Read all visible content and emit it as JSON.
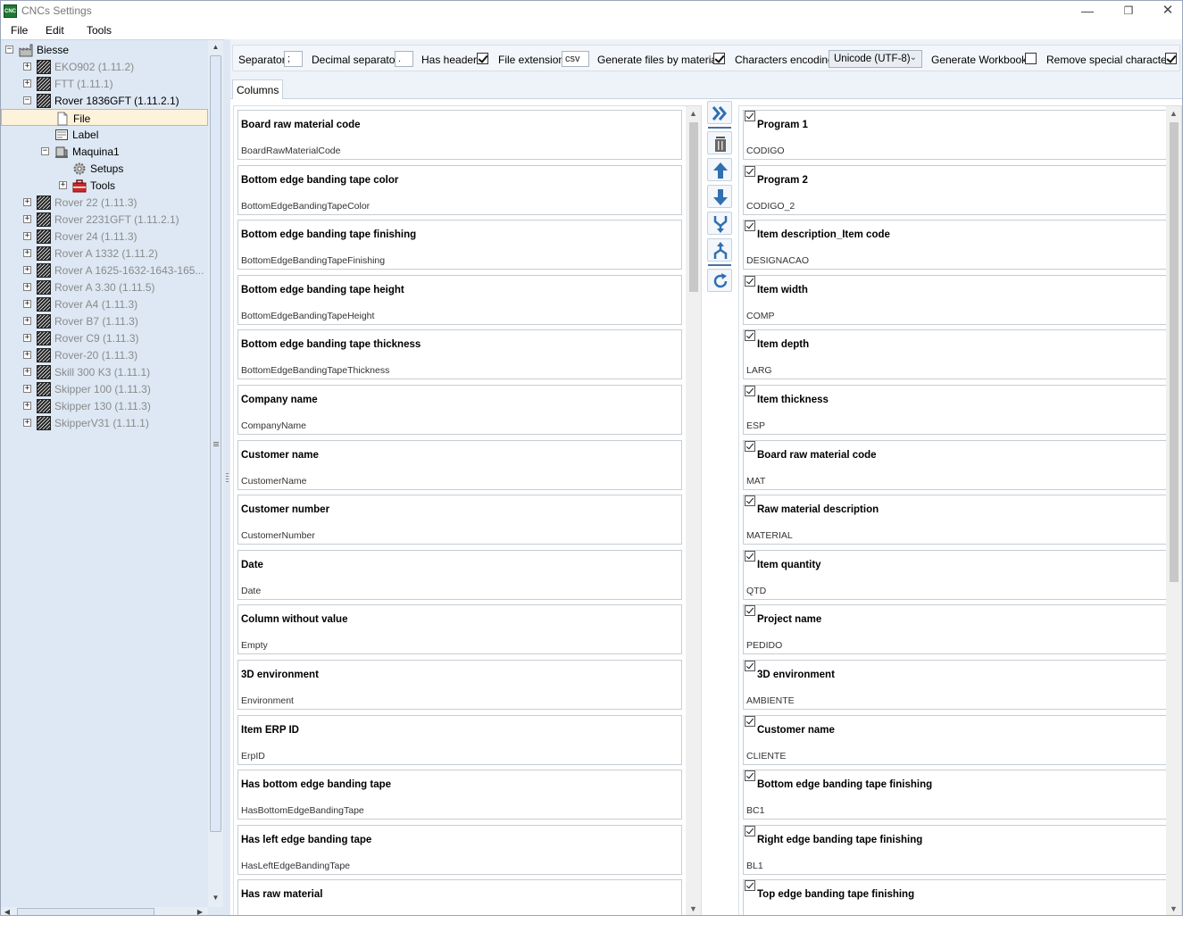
{
  "window": {
    "title": "CNCs Settings",
    "app_icon_text": "CNC",
    "min_glyph": "—",
    "max_glyph": "❐",
    "close_glyph": "✕"
  },
  "menu": [
    "File",
    "Edit",
    "Tools"
  ],
  "tree": {
    "root": "Biesse",
    "items": [
      {
        "label": "EKO902 (1.11.2)",
        "muted": true
      },
      {
        "label": "FTT (1.11.1)",
        "muted": true
      },
      {
        "label": "Rover 1836GFT (1.11.2.1)",
        "muted": false
      },
      {
        "label": "File",
        "muted": false
      },
      {
        "label": "Label",
        "muted": false
      },
      {
        "label": "Maquina1",
        "muted": false
      },
      {
        "label": "Setups",
        "muted": false
      },
      {
        "label": "Tools",
        "muted": false
      },
      {
        "label": "Rover 22 (1.11.3)",
        "muted": true
      },
      {
        "label": "Rover 2231GFT (1.11.2.1)",
        "muted": true
      },
      {
        "label": "Rover 24 (1.11.3)",
        "muted": true
      },
      {
        "label": "Rover A 1332 (1.11.2)",
        "muted": true
      },
      {
        "label": "Rover A 1625-1632-1643-165...",
        "muted": true
      },
      {
        "label": "Rover A 3.30 (1.11.5)",
        "muted": true
      },
      {
        "label": "Rover A4 (1.11.3)",
        "muted": true
      },
      {
        "label": "Rover B7 (1.11.3)",
        "muted": true
      },
      {
        "label": "Rover C9 (1.11.3)",
        "muted": true
      },
      {
        "label": "Rover-20 (1.11.3)",
        "muted": true
      },
      {
        "label": "Skill 300 K3 (1.11.1)",
        "muted": true
      },
      {
        "label": "Skipper 100 (1.11.3)",
        "muted": true
      },
      {
        "label": "Skipper 130 (1.11.3)",
        "muted": true
      },
      {
        "label": "SkipperV31 (1.11.1)",
        "muted": true
      }
    ]
  },
  "toolbar": {
    "separator_label": "Separator",
    "separator_value": ";",
    "decimal_label": "Decimal separator",
    "decimal_value": ".",
    "has_header_label": "Has header",
    "has_header": true,
    "file_ext_label": "File extension",
    "file_ext_value": "csv",
    "gen_by_material_label": "Generate files by material",
    "gen_by_material": true,
    "encoding_label": "Characters encoding",
    "encoding_value": "Unicode (UTF-8)",
    "workbook_label": "Generate Workbook",
    "workbook": false,
    "remove_special_label": "Remove special characters",
    "remove_special": true
  },
  "tabs": [
    "Columns"
  ],
  "available_columns": [
    {
      "title": "Board raw material code",
      "field": "BoardRawMaterialCode"
    },
    {
      "title": "Bottom edge banding tape color",
      "field": "BottomEdgeBandingTapeColor"
    },
    {
      "title": "Bottom edge banding tape finishing",
      "field": "BottomEdgeBandingTapeFinishing"
    },
    {
      "title": "Bottom edge banding tape height",
      "field": "BottomEdgeBandingTapeHeight"
    },
    {
      "title": "Bottom edge banding tape thickness",
      "field": "BottomEdgeBandingTapeThickness"
    },
    {
      "title": "Company name",
      "field": "CompanyName"
    },
    {
      "title": "Customer name",
      "field": "CustomerName"
    },
    {
      "title": "Customer number",
      "field": "CustomerNumber"
    },
    {
      "title": "Date",
      "field": "Date"
    },
    {
      "title": "Column without value",
      "field": "Empty"
    },
    {
      "title": "3D environment",
      "field": "Environment"
    },
    {
      "title": "Item ERP ID",
      "field": "ErpID"
    },
    {
      "title": "Has bottom edge banding tape",
      "field": "HasBottomEdgeBandingTape"
    },
    {
      "title": "Has left edge banding tape",
      "field": "HasLeftEdgeBandingTape"
    },
    {
      "title": "Has raw material",
      "field": ""
    }
  ],
  "selected_columns": [
    {
      "title": "Program 1",
      "field": "CODIGO"
    },
    {
      "title": "Program 2",
      "field": "CODIGO_2"
    },
    {
      "title": "Item description_Item code",
      "field": "DESIGNACAO"
    },
    {
      "title": "Item width",
      "field": "COMP"
    },
    {
      "title": "Item depth",
      "field": "LARG"
    },
    {
      "title": "Item thickness",
      "field": "ESP"
    },
    {
      "title": "Board raw material code",
      "field": "MAT"
    },
    {
      "title": "Raw material description",
      "field": "MATERIAL"
    },
    {
      "title": "Item quantity",
      "field": "QTD"
    },
    {
      "title": "Project name",
      "field": "PEDIDO"
    },
    {
      "title": "3D environment",
      "field": "AMBIENTE"
    },
    {
      "title": "Customer name",
      "field": "CLIENTE"
    },
    {
      "title": "Bottom edge banding tape finishing",
      "field": "BC1"
    },
    {
      "title": "Right edge banding tape finishing",
      "field": "BL1"
    },
    {
      "title": "Top edge banding tape finishing",
      "field": ""
    }
  ],
  "scroll_glyphs": {
    "up": "▲",
    "down": "▼",
    "left": "◀",
    "right": "▶",
    "tree_expand": "+",
    "tree_collapse": "−"
  },
  "colors": {
    "accent": "#2f6fb2",
    "selection_bg": "#fdf2da",
    "selection_border": "#e8b15a",
    "muted_text": "#8a8a8a"
  }
}
